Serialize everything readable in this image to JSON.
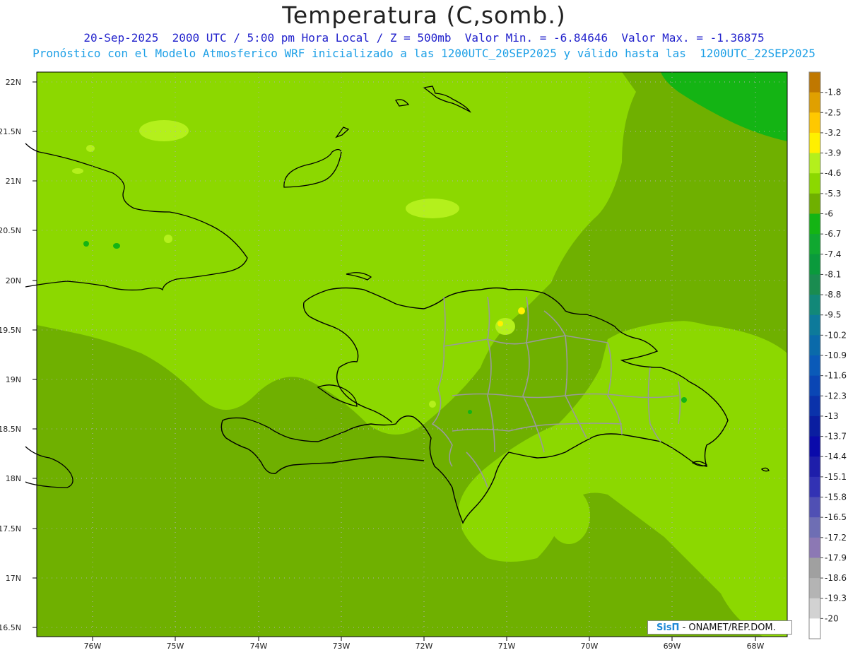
{
  "header": {
    "title": "Temperatura (C,somb.)",
    "subtitle1": "20-Sep-2025  2000 UTC / 5:00 pm Hora Local / Z = 500mb  Valor Min. = -6.84646  Valor Max. = -1.36875",
    "subtitle2": "Pronóstico con el Modelo Atmosferico WRF inicializado a las 1200UTC_20SEP2025 y válido hasta las  1200UTC_22SEP2025"
  },
  "map": {
    "lat_ticks": [
      "22N",
      "21.5N",
      "21N",
      "20.5N",
      "20N",
      "19.5N",
      "19N",
      "18.5N",
      "18N",
      "17.5N",
      "17N",
      "16.5N"
    ],
    "lon_ticks": [
      "76W",
      "75W",
      "74W",
      "73W",
      "72W",
      "71W",
      "70W",
      "69W",
      "68W"
    ],
    "colors": {
      "base_field": "#6fb000",
      "warm_field": "#8cd800",
      "warmer_field": "#b4f01c",
      "cool_field": "#14b414",
      "coastline": "#000000",
      "provinces": "#999999"
    }
  },
  "colorbar": {
    "labels": [
      "-1.8",
      "-2.5",
      "-3.2",
      "-3.9",
      "-4.6",
      "-5.3",
      "-6",
      "-6.7",
      "-7.4",
      "-8.1",
      "-8.8",
      "-9.5",
      "-10.2",
      "-10.9",
      "-11.6",
      "-12.3",
      "-13",
      "-13.7",
      "-14.4",
      "-15.1",
      "-15.8",
      "-16.5",
      "-17.2",
      "-17.9",
      "-18.6",
      "-19.3",
      "-20"
    ],
    "colors": [
      "#c07800",
      "#e0a000",
      "#ffc800",
      "#fff000",
      "#b4f01c",
      "#8cd800",
      "#6fb000",
      "#14b414",
      "#10a830",
      "#0a9a3c",
      "#1a8c50",
      "#128878",
      "#0d7a9a",
      "#0a6aaa",
      "#0a5ab8",
      "#0a46b4",
      "#0a32aa",
      "#0a1ea0",
      "#0a0aaa",
      "#1e1eaa",
      "#3232b4",
      "#5050b4",
      "#6e6eb4",
      "#8c78b4",
      "#a0a0a0",
      "#b4b4b4",
      "#d2d2d2",
      "#ffffff"
    ]
  },
  "credit": {
    "logo": "SisΠ",
    "text": " - ONAMET/REP.DOM."
  }
}
